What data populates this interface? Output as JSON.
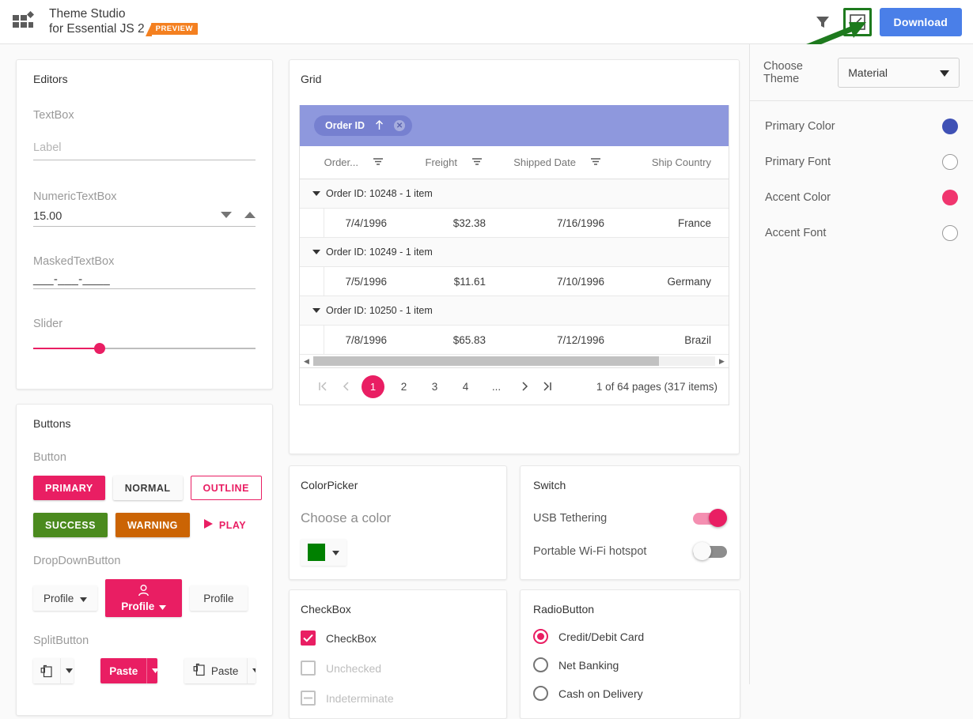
{
  "header": {
    "logo_icon": "grid-squares-logo",
    "title_line1": "Theme Studio",
    "title_line2": "for Essential JS 2",
    "badge": "PREVIEW",
    "filter_icon": "funnel-icon",
    "edit_icon": "edit-customize-icon",
    "download_label": "Download"
  },
  "annotation": {
    "arrow_color": "#1e7a1e",
    "highlight_color": "#1e7a1e"
  },
  "editors": {
    "title": "Editors",
    "textbox": {
      "label": "TextBox",
      "placeholder": "Label",
      "value": ""
    },
    "numeric": {
      "label": "NumericTextBox",
      "value": "15.00",
      "down_icon": "caret-down-icon",
      "up_icon": "caret-up-icon"
    },
    "masked": {
      "label": "MaskedTextBox",
      "value": "___-___-____"
    },
    "slider": {
      "label": "Slider",
      "percent": 30
    }
  },
  "buttons": {
    "title": "Buttons",
    "section_button": "Button",
    "primary": "PRIMARY",
    "normal": "NORMAL",
    "outline": "OUTLINE",
    "success": "SUCCESS",
    "warning": "WARNING",
    "play": "PLAY",
    "play_icon": "play-triangle-icon",
    "section_dropdown": "DropDownButton",
    "dd_profile1": "Profile",
    "dd_profile2": "Profile",
    "dd_profile3": "Profile",
    "profile_icon": "person-icon",
    "section_split": "SplitButton",
    "paste_icon": "paste-clipboard-icon",
    "split_paste1": "Paste",
    "split_paste2": "Paste"
  },
  "grid": {
    "title": "Grid",
    "group_chip": {
      "label": "Order ID",
      "sort_icon": "arrow-up-icon",
      "remove_icon": "close-circle-icon"
    },
    "columns": [
      "Order...",
      "Freight",
      "Shipped Date",
      "Ship Country"
    ],
    "filter_icon": "filter-icon",
    "groups": [
      {
        "header": "Order ID: 10248 - 1 item",
        "rows": [
          [
            "7/4/1996",
            "$32.38",
            "7/16/1996",
            "France"
          ]
        ]
      },
      {
        "header": "Order ID: 10249 - 1 item",
        "rows": [
          [
            "7/5/1996",
            "$11.61",
            "7/10/1996",
            "Germany"
          ]
        ]
      },
      {
        "header": "Order ID: 10250 - 1 item",
        "rows": [
          [
            "7/8/1996",
            "$65.83",
            "7/12/1996",
            "Brazil"
          ]
        ]
      }
    ],
    "pager": {
      "first_icon": "first-page-icon",
      "prev_icon": "prev-page-icon",
      "pages": [
        "1",
        "2",
        "3",
        "4",
        "..."
      ],
      "active_page": "1",
      "next_icon": "next-page-icon",
      "last_icon": "last-page-icon",
      "info": "1 of 64 pages (317 items)"
    }
  },
  "colorpicker": {
    "title": "ColorPicker",
    "hint": "Choose a color",
    "swatch_color": "#008000",
    "dropdown_icon": "caret-down-icon"
  },
  "switch": {
    "title": "Switch",
    "items": [
      {
        "label": "USB Tethering",
        "on": true
      },
      {
        "label": "Portable Wi-Fi hotspot",
        "on": false
      }
    ]
  },
  "checkbox": {
    "title": "CheckBox",
    "items": [
      {
        "label": "CheckBox",
        "state": "checked"
      },
      {
        "label": "Unchecked",
        "state": "unchecked"
      },
      {
        "label": "Indeterminate",
        "state": "indeterminate"
      }
    ]
  },
  "radiobutton": {
    "title": "RadioButton",
    "items": [
      {
        "label": "Credit/Debit Card",
        "selected": true
      },
      {
        "label": "Net Banking",
        "selected": false
      },
      {
        "label": "Cash on Delivery",
        "selected": false
      }
    ]
  },
  "sidebar": {
    "choose_theme_label": "Choose Theme",
    "theme_value": "Material",
    "theme_caret_icon": "caret-down-icon",
    "options": [
      {
        "label": "Primary Color",
        "color": "#3f51b5",
        "filled": true
      },
      {
        "label": "Primary Font",
        "color": "#ffffff",
        "filled": false
      },
      {
        "label": "Accent Color",
        "color": "#f0356e",
        "filled": true
      },
      {
        "label": "Accent Font",
        "color": "#ffffff",
        "filled": false
      }
    ]
  }
}
